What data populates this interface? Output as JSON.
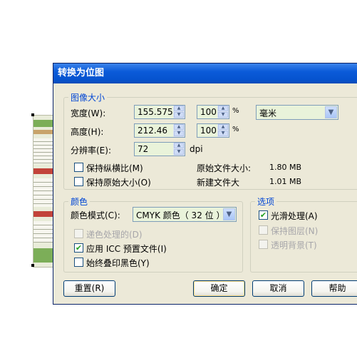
{
  "dialog": {
    "title": "转换为位图"
  },
  "image_size": {
    "legend": "图像大小",
    "width_label": "宽度(W):",
    "width_value": "155.575",
    "width_percent": "100",
    "height_label": "高度(H):",
    "height_value": "212.46",
    "height_percent": "100",
    "percent_sign": "%",
    "unit_selected": "毫米",
    "resolution_label": "分辨率(E):",
    "resolution_value": "72",
    "resolution_unit": "dpi",
    "keep_aspect_label": "保持纵横比(M)",
    "keep_aspect_checked": false,
    "keep_original_label": "保持原始大小(O)",
    "keep_original_checked": false,
    "original_size_label": "原始文件大小:",
    "original_size_value": "1.80 MB",
    "new_size_label": "新建文件大",
    "new_size_value": "1.01 MB"
  },
  "color": {
    "legend": "颜色",
    "mode_label": "颜色模式(C):",
    "mode_value": "CMYK 颜色（ 32 位 ）",
    "dither_label": "递色处理的(D)",
    "dither_checked": false,
    "dither_disabled": true,
    "icc_label": "应用 ICC 预置文件(I)",
    "icc_checked": true,
    "overprint_label": "始终叠印黑色(Y)",
    "overprint_checked": false
  },
  "options": {
    "legend": "选项",
    "antialias_label": "光滑处理(A)",
    "antialias_checked": true,
    "layers_label": "保持图层(N)",
    "layers_checked": false,
    "transparent_label": "透明背景(T)",
    "transparent_checked": false
  },
  "buttons": {
    "reset": "重置(R)",
    "ok": "确定",
    "cancel": "取消",
    "help": "帮助"
  },
  "icons": {
    "check": "✔",
    "up": "▲",
    "down": "▼",
    "combo_arrow": "▼"
  },
  "colors": {
    "title_bar": "#0653cf",
    "dialog_bg": "#ece9d8",
    "legend": "#0046d5",
    "field_bg": "#e9f3da"
  }
}
